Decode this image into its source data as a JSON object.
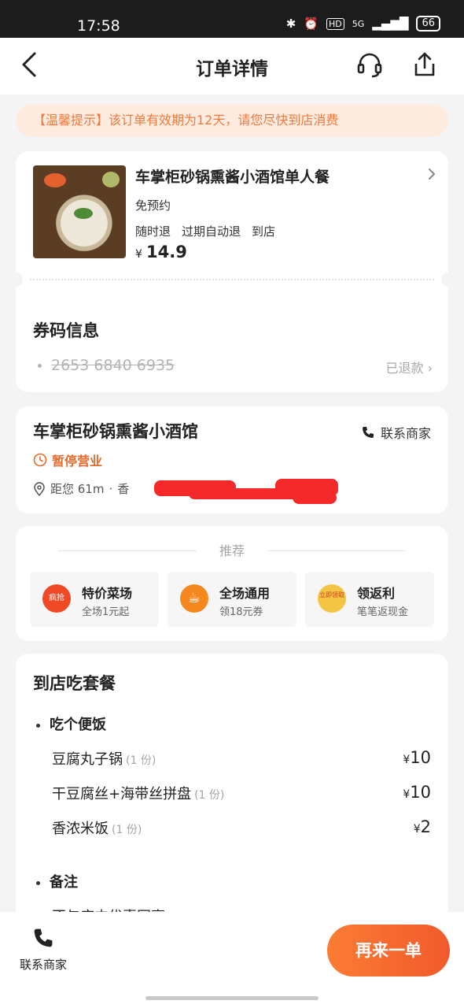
{
  "status_bar": {
    "time": "17:58",
    "network": "5G",
    "hd": "HD",
    "battery": "66"
  },
  "header": {
    "title": "订单详情"
  },
  "tip": {
    "text": "【温馨提示】该订单有效期为12天，请您尽快到店消费"
  },
  "product": {
    "name": "车掌柜砂锅熏酱小酒馆单人餐",
    "reservation": "免预约",
    "tags": [
      "随时退",
      "过期自动退",
      "到店"
    ],
    "currency": "¥",
    "price": "14.9"
  },
  "coupon": {
    "title": "券码信息",
    "code": "2653 6840 6935",
    "status": "已退款"
  },
  "shop": {
    "name": "车掌柜砂锅熏酱小酒馆",
    "contact_label": "联系商家",
    "status": "暂停营业",
    "distance": "距您 61m",
    "separator": "·",
    "address_visible": "香"
  },
  "recommend": {
    "title": "推荐",
    "items": [
      {
        "name": "特价菜场",
        "desc": "全场1元起",
        "badge": "疯抢",
        "color": "#ef4a25"
      },
      {
        "name": "全场通用",
        "desc": "领18元券",
        "badge": "",
        "color": "#f5871f"
      },
      {
        "name": "领返利",
        "desc": "笔笔返现金",
        "badge": "立即领取",
        "color": "#f4c542"
      }
    ]
  },
  "package": {
    "title": "到店吃套餐",
    "section_meal": "吃个便饭",
    "items": [
      {
        "name": "豆腐丸子锅",
        "qty": "(1 份)",
        "currency": "¥",
        "price": "10"
      },
      {
        "name": "干豆腐丝+海带丝拼盘",
        "qty": "(1 份)",
        "currency": "¥",
        "price": "10"
      },
      {
        "name": "香浓米饭",
        "qty": "(1 份)",
        "currency": "¥",
        "price": "2"
      }
    ],
    "section_note": "备注",
    "note_partial": "不与店内优惠同享"
  },
  "bottom": {
    "contact_label": "联系商家",
    "reorder_label": "再来一单"
  },
  "colors": {
    "accent": "#f15a2b",
    "tip_bg": "#fdebe0",
    "tip_text": "#f07a3c",
    "closed_status": "#e86a2b",
    "refunded": "#a8a8a8"
  }
}
